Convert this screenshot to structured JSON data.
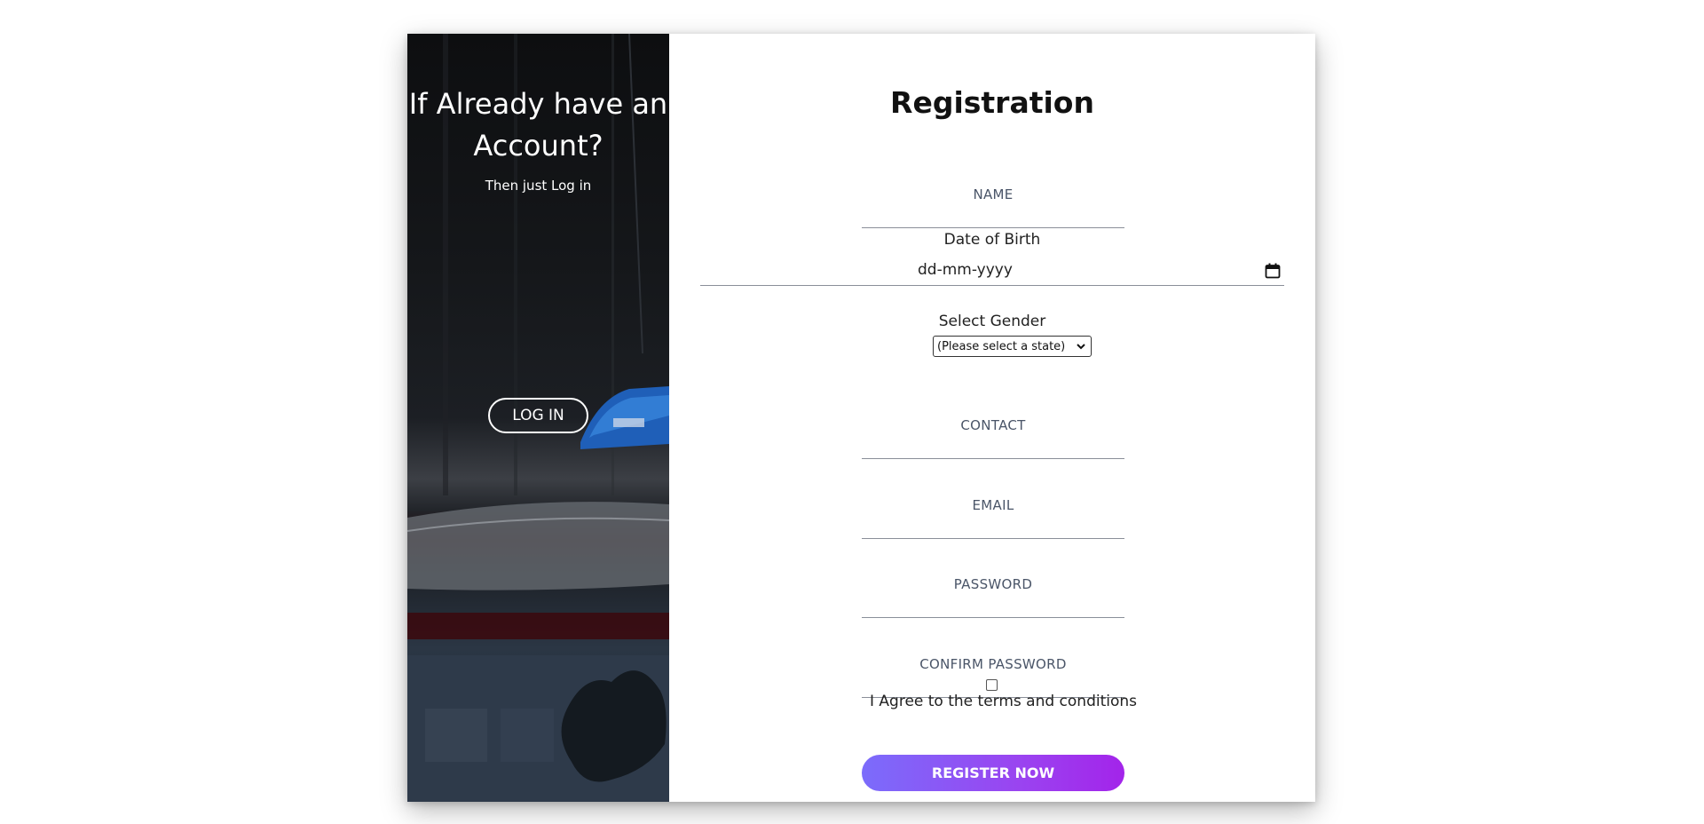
{
  "side_panel": {
    "heading": "If Already have an Account?",
    "subheading": "Then just Log in",
    "login_button": "LOG IN"
  },
  "form": {
    "title": "Registration",
    "name_label": "NAME",
    "dob_label": "Date of Birth",
    "dob_placeholder": "dd-mm-yyyy",
    "gender_label": "Select Gender",
    "gender_selected": "(Please select a state)",
    "contact_label": "CONTACT",
    "email_label": "EMAIL",
    "password_label": "PASSWORD",
    "confirm_password_label": "CONFIRM PASSWORD",
    "agree_text": "I Agree to the terms and conditions",
    "register_button": "REGISTER NOW"
  },
  "icons": {
    "calendar": "calendar-icon",
    "dropdown": "chevron-down-icon"
  },
  "colors": {
    "register_gradient_start": "#7b6cfb",
    "register_gradient_end": "#a324ea",
    "label_color": "#4a5568"
  }
}
